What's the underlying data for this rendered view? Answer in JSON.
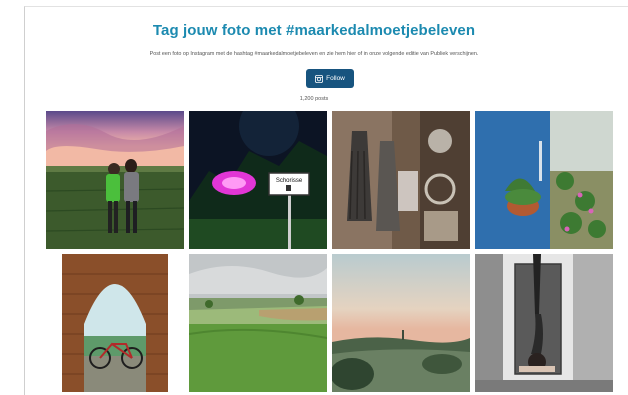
{
  "header": {
    "title": "Tag jouw foto met #maarkedalmoetjebeleven",
    "subtitle": "Post een foto op Instagram met de hashtag #maarkedalmoetjebeleven en zie hem hier of in onze volgende editie van Publiek verschijnen.",
    "follow_label": "Follow",
    "posts_count": "1,200 posts"
  },
  "photos": [
    {
      "name": "photo-sunset-couple",
      "sign_text": ""
    },
    {
      "name": "photo-night-roadsign",
      "sign_text": "Schorisse"
    },
    {
      "name": "photo-antique-tassels",
      "sign_text": ""
    },
    {
      "name": "photo-blue-wall-plants",
      "sign_text": ""
    },
    {
      "name": "photo-bicycle-arch",
      "sign_text": ""
    },
    {
      "name": "photo-green-fields",
      "sign_text": ""
    },
    {
      "name": "photo-dusk-valley",
      "sign_text": ""
    },
    {
      "name": "photo-handstand",
      "sign_text": ""
    }
  ],
  "colors": {
    "title": "#1c8ab0",
    "follow_button": "#17547f"
  }
}
